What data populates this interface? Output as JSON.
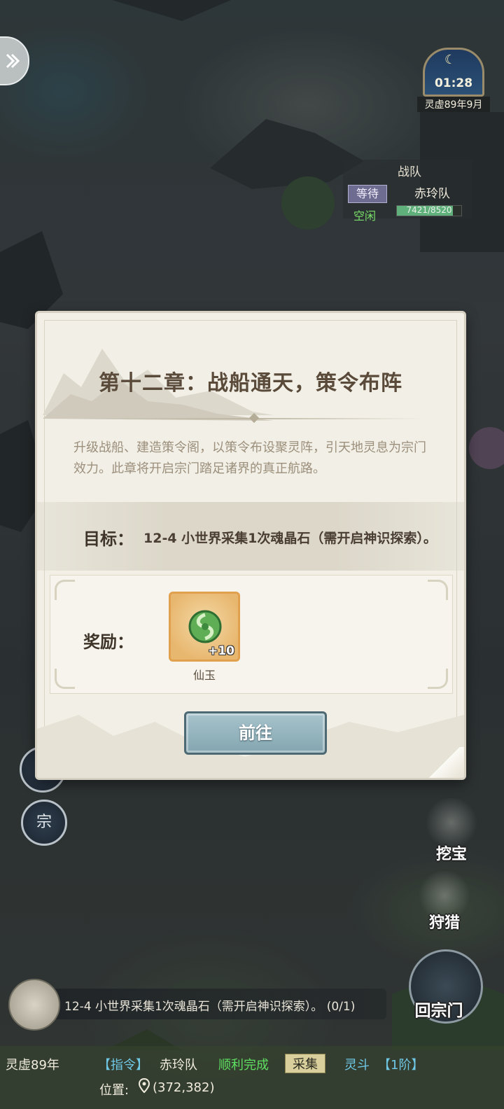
{
  "clock": {
    "time": "01:28",
    "date": "灵虚89年9月"
  },
  "team": {
    "title": "战队",
    "state": "等待",
    "name": "赤玲队",
    "status": "空闲",
    "hp": "7421/8520",
    "hp_fraction": 0.871
  },
  "dialog": {
    "title": "第十二章：战船通天，策令布阵",
    "description": "升级战船、建造策令阁，以策令布设聚灵阵，引天地灵息为宗门效力。此章将开启宗门踏足诸界的真正航路。",
    "goal_label": "目标：",
    "goal_text": "12-4 小世界采集1次魂晶石（需开启神识探索）。",
    "reward_label": "奖励：",
    "reward": {
      "name": "仙玉",
      "count": "+10"
    },
    "go_button": "前往"
  },
  "left_buttons": {
    "sect": "宗"
  },
  "actions": {
    "dig": "挖宝",
    "hunt": "狩猎",
    "return": "回宗门"
  },
  "task": {
    "text": "12-4 小世界采集1次魂晶石（需开启神识探索）。 (0/1)"
  },
  "bottom": {
    "year": "灵虚89年",
    "command": "【指令】",
    "team": "赤玲队",
    "result": "顺利完成",
    "action": "采集",
    "spirit": "灵斗",
    "tier": "【1阶】",
    "position_label": "位置:",
    "position": "(372,382)"
  },
  "colors": {
    "accent_green": "#7ae06a",
    "button_blue": "#84a6b0",
    "title_brown": "#5a4a3a"
  }
}
